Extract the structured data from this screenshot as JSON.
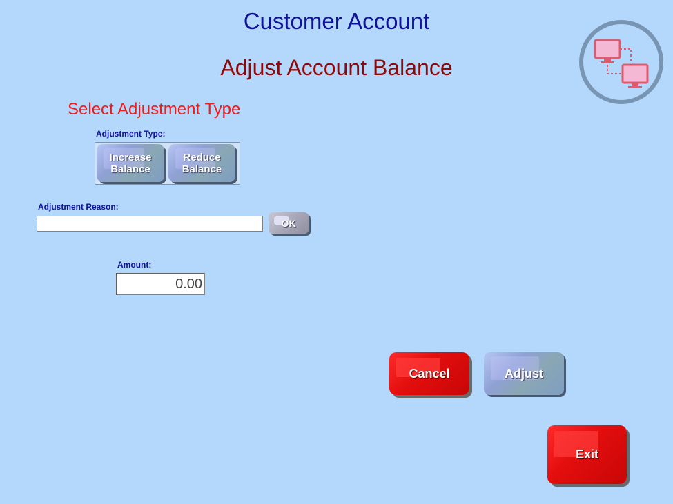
{
  "header": {
    "title": "Customer Account",
    "subtitle": "Adjust Account Balance"
  },
  "section": {
    "heading": "Select Adjustment Type"
  },
  "adjustment_type": {
    "label": "Adjustment Type:",
    "increase_line1": "Increase",
    "increase_line2": "Balance",
    "reduce_line1": "Reduce",
    "reduce_line2": "Balance"
  },
  "adjustment_reason": {
    "label": "Adjustment Reason:",
    "value": "",
    "ok_label": "OK"
  },
  "amount": {
    "label": "Amount:",
    "value": "0.00"
  },
  "actions": {
    "cancel_label": "Cancel",
    "adjust_label": "Adjust",
    "exit_label": "Exit"
  },
  "logo": {
    "icon": "network-computers-icon"
  },
  "colors": {
    "background": "#b4d8fc",
    "title": "#10129c",
    "subtitle": "#8c0a0a",
    "section_heading": "#ee1c1c",
    "red_button": "#e40e0e"
  }
}
